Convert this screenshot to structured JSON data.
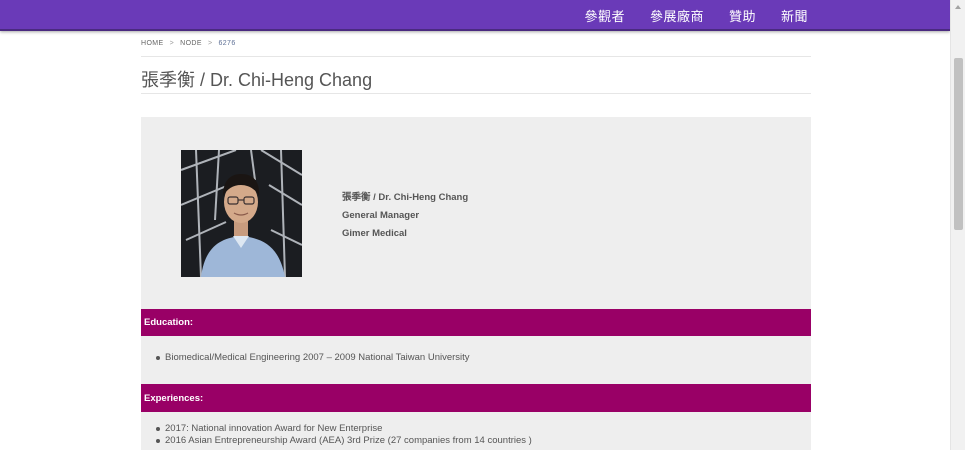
{
  "nav": {
    "items": [
      "參觀者",
      "參展廠商",
      "贊助",
      "新聞"
    ]
  },
  "breadcrumb": {
    "home": "HOME",
    "node": "NODE",
    "current": "6276",
    "separator": ">"
  },
  "page": {
    "title": "張季衡 / Dr. Chi-Heng Chang"
  },
  "profile": {
    "name": "張季衡 / Dr. Chi-Heng Chang",
    "position": "General Manager",
    "company": "Gimer Medical"
  },
  "education": {
    "heading": "Education:",
    "items": [
      "Biomedical/Medical Engineering 2007 – 2009 National Taiwan University"
    ]
  },
  "experiences": {
    "heading": "Experiences:",
    "items": [
      "2017: National innovation Award for New Enterprise",
      "2016 Asian Entrepreneurship Award (AEA) 3rd Prize (27 companies from 14 countries )"
    ]
  },
  "colors": {
    "topbar": "#6a3ab8",
    "section_header": "#990066",
    "panel_bg": "#eeeeee"
  }
}
